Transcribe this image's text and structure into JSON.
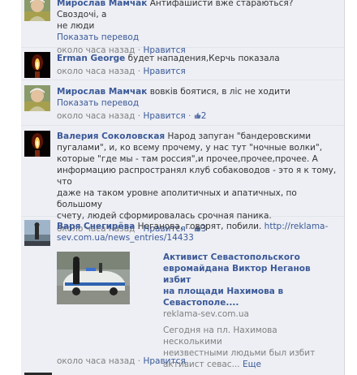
{
  "comments": [
    {
      "author": "Мирослав Мамчак",
      "text_line1": "Антифашисти вже стараються? Своздочі, а",
      "text_line2": "не люди",
      "translate": "Показать перевод",
      "time": "около часа назад",
      "sep": "·",
      "like": "Нравится"
    },
    {
      "author": "Erman George",
      "text": "будет нападения,Керчь показала",
      "time": "около часа назад",
      "sep": "·",
      "like": "Нравится"
    },
    {
      "author": "Мирослав Мамчак",
      "text": "вовків боятися, в ліс не ходити",
      "translate": "Показать перевод",
      "time": "около часа назад",
      "sep": "·",
      "like": "Нравится",
      "likes_count": "2"
    },
    {
      "author": "Валерия Соколовская",
      "text_l1": "Народ запуган \"бандеровскими",
      "text_l2": "пугалами\", и, ко всему прочему, у нас тут \"ночные волки\",",
      "text_l3": "которые \"где мы - там россия\",и прочее,прочее,прочее. А",
      "text_l4": "информацию распространял клуб собаководов - это я к тому, что",
      "text_l5": "даже на таком уровне аполитичных и апатичных, по большому",
      "text_l6": "счету, людей сформировалась срочная паника.",
      "time": "около часа назад",
      "sep": "·",
      "like": "Нравится",
      "likes_count": "3"
    },
    {
      "author": "Варя Снегирёва",
      "text": "Неганова, говорят, побили.",
      "url_l1": "http://reklama-",
      "url_l2": "sev.com.ua/news_entries/14433",
      "preview": {
        "title_l1": "Активист Севастопольского",
        "title_l2": "евромайдана Виктор Неганов избит",
        "title_l3": "на площади Нахимова в",
        "title_l4": "Севастополе....",
        "domain": "reklama-sev.com.ua",
        "summary_l1": "Сегодня на пл. Нахимова несколькими",
        "summary_l2": "неизвестными людьми был избит",
        "summary_l3": "активист севас...",
        "more": "Еще"
      },
      "time": "около часа назад",
      "sep": "·",
      "like": "Нравится"
    }
  ]
}
